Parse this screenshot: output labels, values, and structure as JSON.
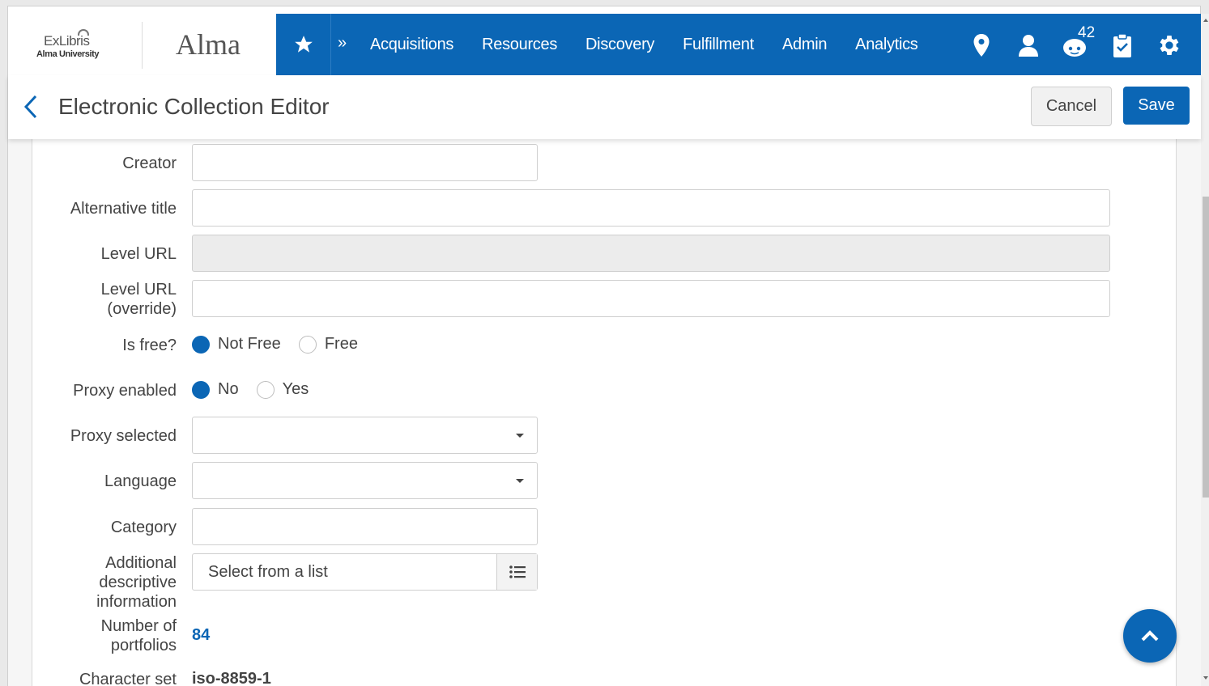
{
  "brand": {
    "logo_main": "ExLibris",
    "logo_sub": "Alma University",
    "app_name": "Alma"
  },
  "nav": {
    "items": [
      "Acquisitions",
      "Resources",
      "Discovery",
      "Fulfillment",
      "Admin",
      "Analytics"
    ],
    "notification_count": "42",
    "icons": [
      "star-icon",
      "expand-icon",
      "location-pin-icon",
      "user-icon",
      "tasks-bot-icon",
      "clipboard-check-icon",
      "gear-icon"
    ],
    "accent_color": "#0b66b5"
  },
  "header": {
    "title": "Electronic Collection Editor",
    "cancel_label": "Cancel",
    "save_label": "Save"
  },
  "form": {
    "creator": {
      "label": "Creator",
      "value": ""
    },
    "alternative_title": {
      "label": "Alternative title",
      "value": ""
    },
    "level_url": {
      "label": "Level URL",
      "value": ""
    },
    "level_url_override": {
      "label_line1": "Level URL",
      "label_line2": "(override)",
      "value": ""
    },
    "is_free": {
      "label": "Is free?",
      "options": [
        "Not Free",
        "Free"
      ],
      "selected": "Not Free"
    },
    "proxy_enabled": {
      "label": "Proxy enabled",
      "options": [
        "No",
        "Yes"
      ],
      "selected": "No"
    },
    "proxy_selected": {
      "label": "Proxy selected",
      "value": ""
    },
    "language": {
      "label": "Language",
      "value": ""
    },
    "category": {
      "label": "Category",
      "value": ""
    },
    "additional_info": {
      "label_line1": "Additional",
      "label_line2": "descriptive",
      "label_line3": "information",
      "placeholder": "Select from a list"
    },
    "num_portfolios": {
      "label_line1": "Number of",
      "label_line2": "portfolios",
      "value": "84"
    },
    "character_set": {
      "label": "Character set",
      "value": "iso-8859-1"
    }
  }
}
